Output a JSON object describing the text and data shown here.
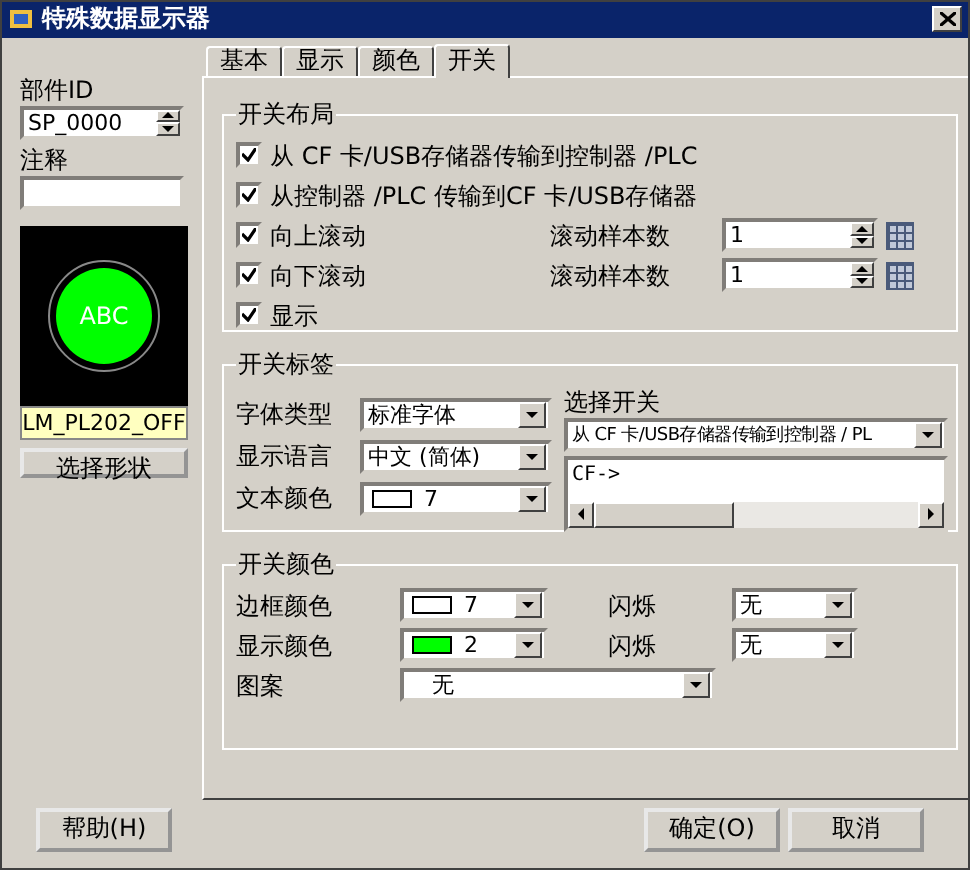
{
  "window": {
    "title": "特殊数据显示器"
  },
  "left": {
    "part_id_label": "部件ID",
    "part_id": "SP_0000",
    "comment_label": "注释",
    "preview_text": "ABC",
    "shape_name": "LM_PL202_OFF",
    "select_shape": "选择形状"
  },
  "tabs": [
    {
      "label": "基本",
      "selected": false
    },
    {
      "label": "显示",
      "selected": false
    },
    {
      "label": "颜色",
      "selected": false
    },
    {
      "label": "开关",
      "selected": true
    }
  ],
  "layout": {
    "title": "开关布局",
    "options": [
      {
        "kind": "check",
        "label": "从 CF 卡/USB存储器传输到控制器 /PLC",
        "checked": true
      },
      {
        "kind": "check",
        "label": "从控制器 /PLC 传输到CF 卡/USB存储器",
        "checked": true
      },
      {
        "kind": "scroll",
        "label": "向上滚动",
        "checked": true,
        "count_label": "滚动样本数",
        "count": "1"
      },
      {
        "kind": "scroll",
        "label": "向下滚动",
        "checked": true,
        "count_label": "滚动样本数",
        "count": "1"
      },
      {
        "kind": "check",
        "label": "显示",
        "checked": true
      }
    ]
  },
  "switch_label": {
    "title": "开关标签",
    "rows": [
      {
        "kind": "plain",
        "label": "字体类型",
        "value": "标准字体"
      },
      {
        "kind": "plain",
        "label": "显示语言",
        "value": "中文 (简体)"
      },
      {
        "kind": "swatch",
        "label": "文本颜色",
        "value": "7",
        "color": "#ffffff"
      }
    ],
    "select_title": "选择开关",
    "select_value": "从 CF 卡/USB存储器传输到控制器 / PL",
    "text": "CF->"
  },
  "switch_color": {
    "title": "开关颜色",
    "rows": [
      {
        "label": "边框颜色",
        "value": "7",
        "color": "#ffffff",
        "blink_label": "闪烁",
        "blink": "无"
      },
      {
        "label": "显示颜色",
        "value": "2",
        "color": "#00ff00",
        "blink_label": "闪烁",
        "blink": "无"
      }
    ],
    "pattern_label": "图案",
    "pattern": "无"
  },
  "buttons": {
    "help": "帮助(H)",
    "ok": "确定(O)",
    "cancel": "取消"
  }
}
